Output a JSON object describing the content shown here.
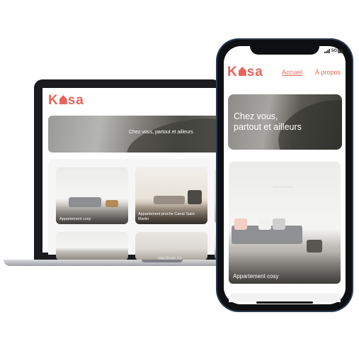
{
  "brand": {
    "logo_prefix": "K",
    "logo_suffix": "sa",
    "accent": "#E8645B"
  },
  "laptop": {
    "model_label": "MacBook Air",
    "banner_text": "Chez vous, partout et ailleurs",
    "cards": [
      {
        "title": "Appartement cosy"
      },
      {
        "title": "Appartement proche Canal Saint Martin"
      }
    ]
  },
  "phone": {
    "status_signal": "5G",
    "nav": [
      {
        "label": "Accueil"
      },
      {
        "label": "À propos"
      }
    ],
    "banner_line1": "Chez vous,",
    "banner_line2": "partout et ailleurs",
    "card_title": "Appartement cosy"
  }
}
